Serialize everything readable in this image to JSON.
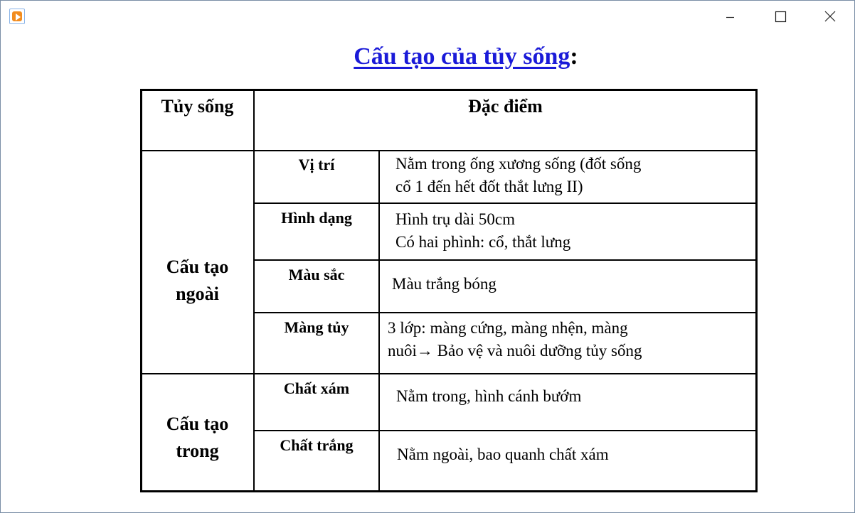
{
  "window": {
    "icon": "media-player-icon",
    "controls": {
      "minimize": "minimize-icon",
      "maximize": "maximize-icon",
      "close": "close-icon"
    }
  },
  "title": {
    "link_text": "Cấu tạo của tủy sống",
    "suffix": ":"
  },
  "table": {
    "header": {
      "col1": "Tủy sống",
      "col2": "Đặc điểm"
    },
    "groups": [
      {
        "label_line1": "Cấu tạo",
        "label_line2": "ngoài",
        "rows": [
          {
            "attr": "Vị trí",
            "desc1": "Nằm trong ống xương sống (đốt sống",
            "desc2": "cổ 1 đến hết đốt thắt lưng II)"
          },
          {
            "attr": "Hình dạng",
            "desc1": "Hình trụ dài 50cm",
            "desc2": "Có hai phình: cổ, thắt lưng"
          },
          {
            "attr": "Màu sắc",
            "desc1": "Màu trắng bóng"
          },
          {
            "attr": "Màng tủy",
            "desc1": "3 lớp: màng cứng, màng nhện, màng",
            "desc2": "nuôi→ Bảo vệ và nuôi dưỡng tủy sống"
          }
        ]
      },
      {
        "label_line1": "Cấu tạo",
        "label_line2": "trong",
        "rows": [
          {
            "attr": "Chất xám",
            "desc1": "Nằm trong, hình cánh bướm"
          },
          {
            "attr": "Chất trắng",
            "desc1": "Nằm ngoài, bao quanh chất xám"
          }
        ]
      }
    ]
  }
}
